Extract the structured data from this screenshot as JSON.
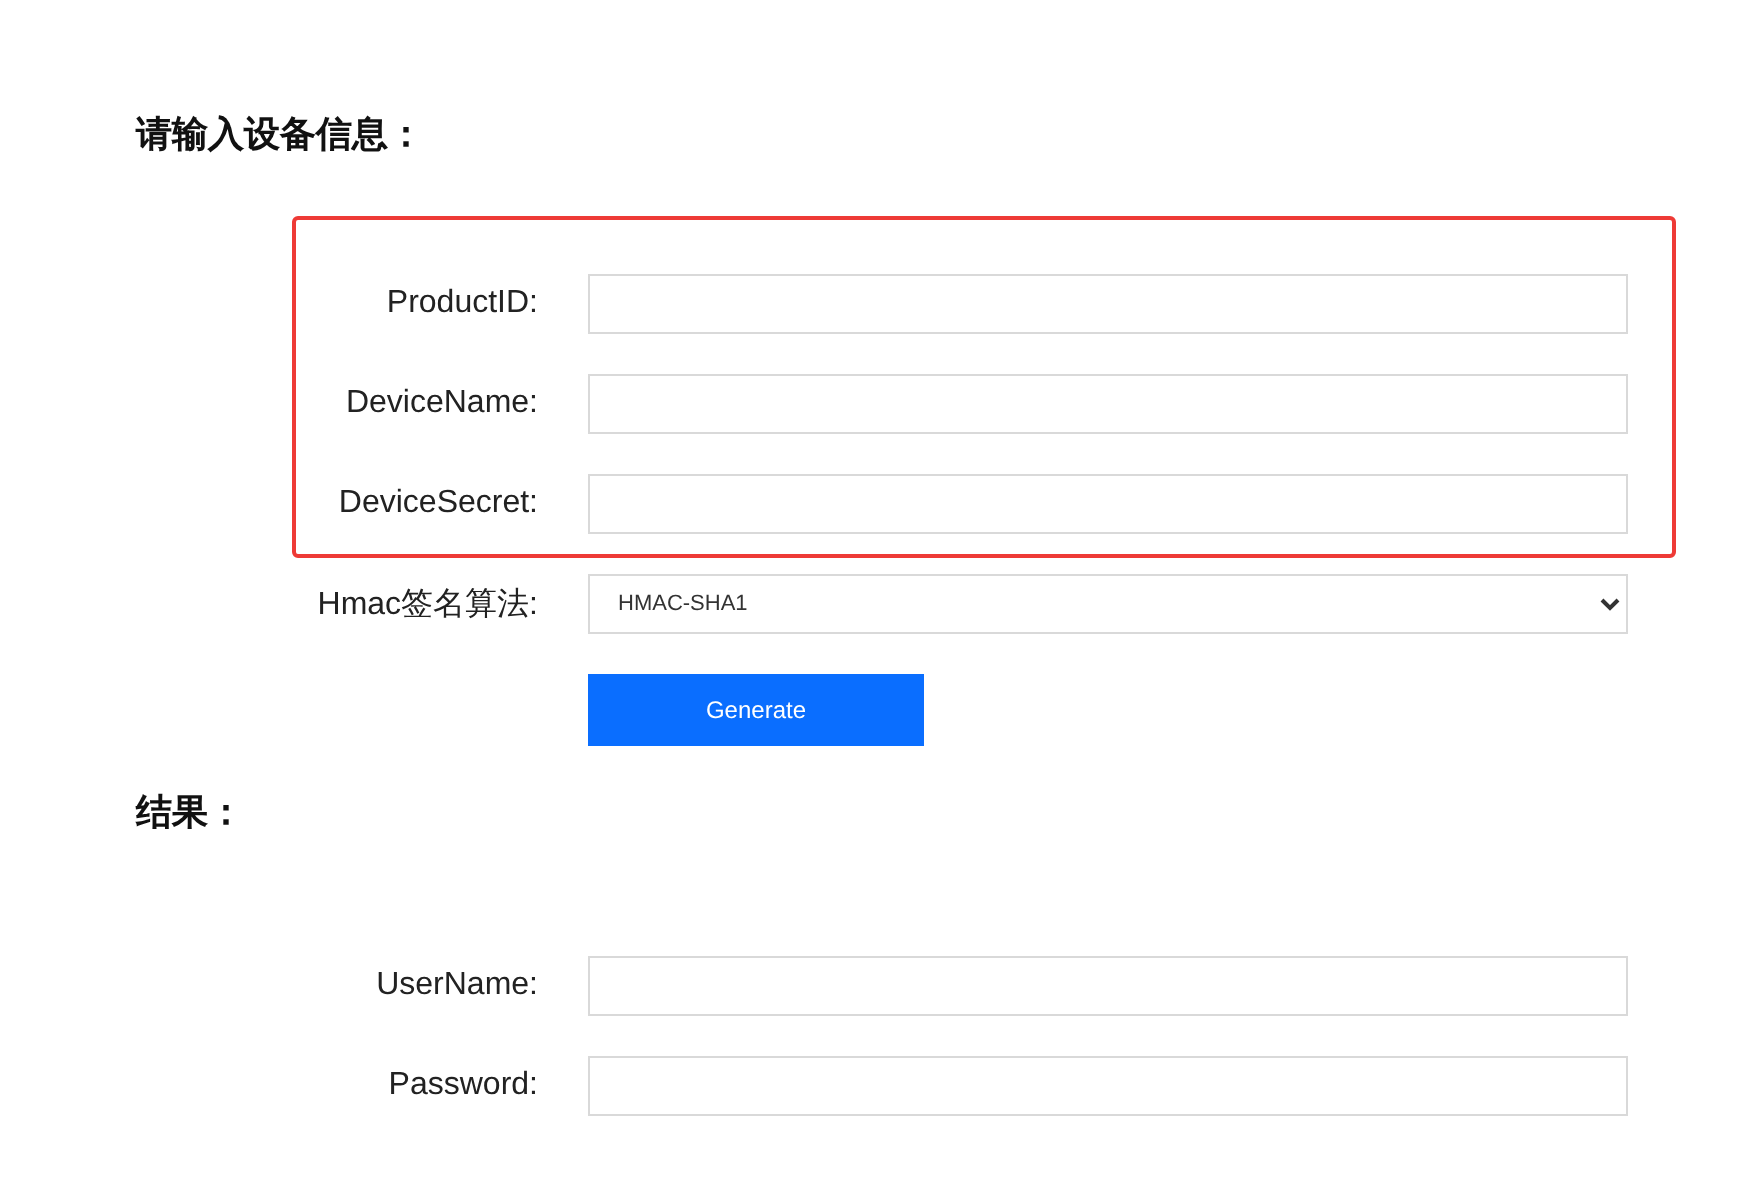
{
  "input_section": {
    "heading": "请输入设备信息：",
    "highlighted": true,
    "fields": [
      {
        "label": "ProductID:"
      },
      {
        "label": "DeviceName:"
      },
      {
        "label": "DeviceSecret:"
      }
    ],
    "algorithm": {
      "label": "Hmac签名算法:",
      "value": "HMAC-SHA1"
    },
    "button": "Generate"
  },
  "result_section": {
    "heading": "结果：",
    "fields": [
      {
        "label": "UserName:"
      },
      {
        "label": "Password:"
      }
    ]
  }
}
